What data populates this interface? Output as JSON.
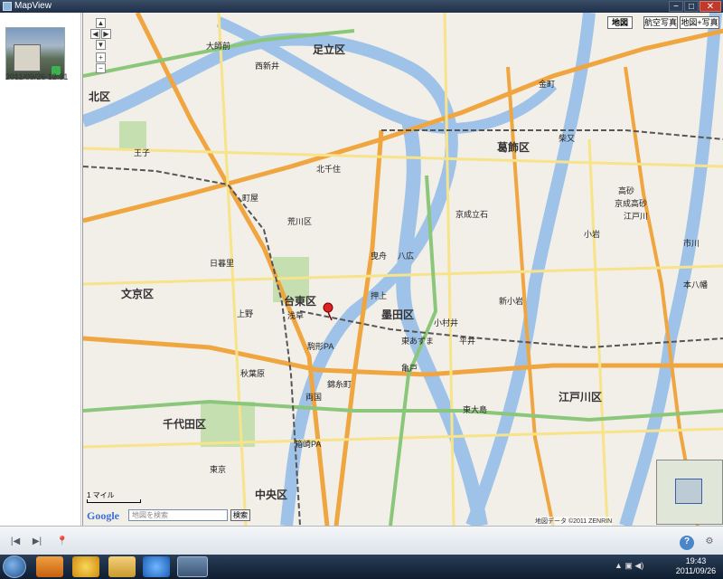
{
  "window": {
    "title": "MapView",
    "minimize_glyph": "−",
    "maximize_glyph": "□",
    "close_glyph": "✕"
  },
  "photo": {
    "caption": "2011/09/26 12:31"
  },
  "map": {
    "type_buttons": [
      "地図",
      "航空写真",
      "地図+写真"
    ],
    "active_type": "地図",
    "search_placeholder": "地図を検索",
    "search_button": "検索",
    "google_logo": "Google",
    "scale_label": "1 マイル",
    "copyright": "地図データ ©2011 ZENRIN",
    "labels": [
      {
        "text": "北区",
        "big": true
      },
      {
        "text": "足立区",
        "big": true
      },
      {
        "text": "葛飾区",
        "big": true
      },
      {
        "text": "文京区",
        "big": true
      },
      {
        "text": "台東区",
        "big": true
      },
      {
        "text": "墨田区",
        "big": true
      },
      {
        "text": "江戸川区",
        "big": true
      },
      {
        "text": "千代田区",
        "big": true
      },
      {
        "text": "中央区",
        "big": true
      },
      {
        "text": "荒川区",
        "big": false
      },
      {
        "text": "北千住",
        "big": false
      },
      {
        "text": "大師前",
        "big": false
      },
      {
        "text": "西新井",
        "big": false
      },
      {
        "text": "王子",
        "big": false
      },
      {
        "text": "上野",
        "big": false
      },
      {
        "text": "浅草",
        "big": false
      },
      {
        "text": "錦糸町",
        "big": false
      },
      {
        "text": "亀戸",
        "big": false
      },
      {
        "text": "押上",
        "big": false
      },
      {
        "text": "東京",
        "big": false
      },
      {
        "text": "金町",
        "big": false
      },
      {
        "text": "柴又",
        "big": false
      },
      {
        "text": "江戸川",
        "big": false
      },
      {
        "text": "小岩",
        "big": false
      },
      {
        "text": "新小岩",
        "big": false
      },
      {
        "text": "平井",
        "big": false
      },
      {
        "text": "京成立石",
        "big": false
      },
      {
        "text": "町屋",
        "big": false
      },
      {
        "text": "日暮里",
        "big": false
      },
      {
        "text": "秋葉原",
        "big": false
      },
      {
        "text": "両国",
        "big": false
      },
      {
        "text": "東大島",
        "big": false
      },
      {
        "text": "駒形PA",
        "big": false
      },
      {
        "text": "箱崎PA",
        "big": false
      },
      {
        "text": "市川",
        "big": false
      },
      {
        "text": "本八幡",
        "big": false
      },
      {
        "text": "高砂",
        "big": false
      },
      {
        "text": "京成高砂",
        "big": false
      },
      {
        "text": "曳舟",
        "big": false
      },
      {
        "text": "東あずま",
        "big": false
      },
      {
        "text": "八広",
        "big": false
      },
      {
        "text": "小村井",
        "big": false
      }
    ]
  },
  "toolbar": {
    "prev_glyph": "|◀",
    "next_glyph": "▶|",
    "pin_glyph": "📍",
    "help_glyph": "?",
    "tool_glyph": "⚙"
  },
  "taskbar": {
    "time": "19:43",
    "date": "2011/09/26",
    "tray_text": "▲ ▣ ◀)"
  }
}
